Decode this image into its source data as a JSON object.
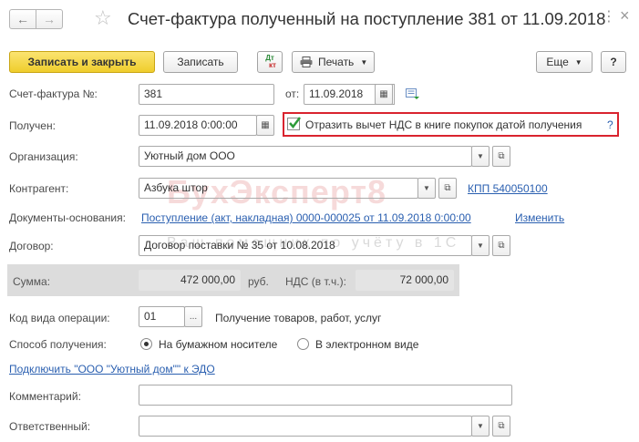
{
  "window": {
    "title": "Счет-фактура полученный на поступление 381 от 11.09.2018",
    "close_glyph": "×"
  },
  "toolbar": {
    "save_close_label": "Записать и закрыть",
    "save_label": "Записать",
    "dtkt_top": "Дт",
    "dtkt_bottom": "кт",
    "print_label": "Печать",
    "more_label": "Еще",
    "help_label": "?"
  },
  "form": {
    "invoice_label": "Счет-фактура №:",
    "invoice_number": "381",
    "from_label": "от:",
    "invoice_date": "11.09.2018",
    "received_label": "Получен:",
    "received_datetime": "11.09.2018  0:00:00",
    "vat_checkbox_label": "Отразить вычет НДС в книге покупок датой получения",
    "vat_checkbox_help": "?",
    "org_label": "Организация:",
    "org_value": "Уютный дом ООО",
    "counterparty_label": "Контрагент:",
    "counterparty_value": "Азбука штор",
    "kpp_link": "КПП 540050100",
    "base_docs_label": "Документы-основания:",
    "base_docs_link": "Поступление (акт, накладная) 0000-000025 от 11.09.2018 0:00:00",
    "change_link": "Изменить",
    "contract_label": "Договор:",
    "contract_value": "Договор поставки № 35 от 10.08.2018",
    "sum_label": "Сумма:",
    "sum_value": "472 000,00",
    "currency": "руб.",
    "vat_label": "НДС (в т.ч.):",
    "vat_value": "72 000,00",
    "op_code_label": "Код вида операции:",
    "op_code_value": "01",
    "op_code_desc": "Получение товаров, работ, услуг",
    "method_label": "Способ получения:",
    "method_paper": "На бумажном носителе",
    "method_electronic": "В электронном виде",
    "edo_link": "Подключить \"ООО \"Уютный дом\"\" к ЭДО",
    "comment_label": "Комментарий:",
    "comment_value": "",
    "responsible_label": "Ответственный:",
    "responsible_value": ""
  },
  "watermark": {
    "brand": "БухЭксперт8",
    "tagline": "Ваш помощник по учёту в 1С"
  },
  "colors": {
    "primary_button": "#f5d84a",
    "link": "#2a5fb0",
    "highlight_border": "#d9232e",
    "checkbox_mark": "#2e9b3a",
    "sum_panel": "#dcdcdc"
  },
  "icons": {
    "back": "arrow-left-icon",
    "forward": "arrow-right-icon",
    "favorite": "star-icon",
    "more_vertical": "more-vertical-icon",
    "close": "close-icon",
    "calendar": "calendar-icon",
    "open": "open-link-icon",
    "dropdown": "chevron-down-icon"
  }
}
